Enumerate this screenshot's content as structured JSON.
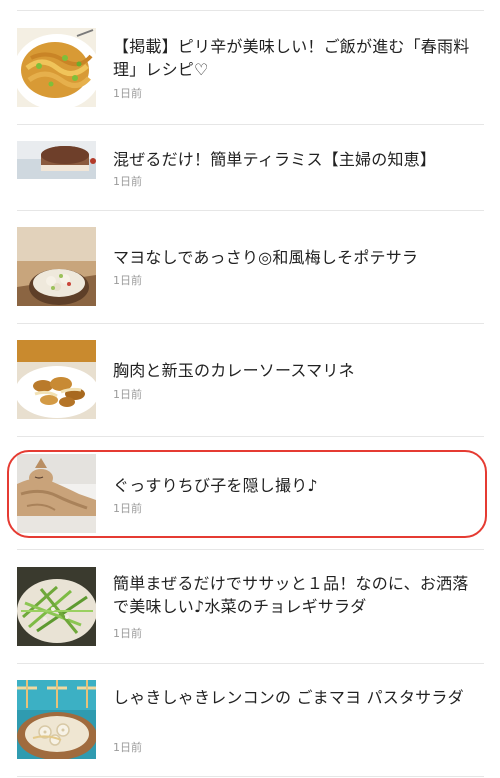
{
  "articles": [
    {
      "title": "【掲載】ピリ辛が美味しい！ご飯が進む「春雨料理」レシピ♡",
      "time": "1日前",
      "thumb_icon": "stir-fried-noodles-photo"
    },
    {
      "title": "混ぜるだけ！簡単ティラミス【主婦の知恵】",
      "time": "1日前",
      "thumb_icon": "tiramisu-photo"
    },
    {
      "title": "マヨなしであっさり◎和風梅しそポテサラ",
      "time": "1日前",
      "thumb_icon": "potato-salad-photo"
    },
    {
      "title": "胸肉と新玉のカレーソースマリネ",
      "time": "1日前",
      "thumb_icon": "chicken-marinade-photo"
    },
    {
      "title": "ぐっすりちび子を隠し撮り♪",
      "time": "1日前",
      "thumb_icon": "sleeping-cat-photo"
    },
    {
      "title": "簡単まぜるだけでササッと１品！なのに、お洒落で美味しい♪水菜のチョレギサラダ",
      "time": "1日前",
      "thumb_icon": "mizuna-salad-photo"
    },
    {
      "title": "しゃきしゃきレンコンの ごまマヨ パスタサラダ",
      "time": "1日前",
      "thumb_icon": "lotus-root-pasta-salad-photo"
    }
  ],
  "colors": {
    "highlight_ring": "#e53b32",
    "divider": "#e6e6e6",
    "meta_text": "#9b9b9b"
  }
}
